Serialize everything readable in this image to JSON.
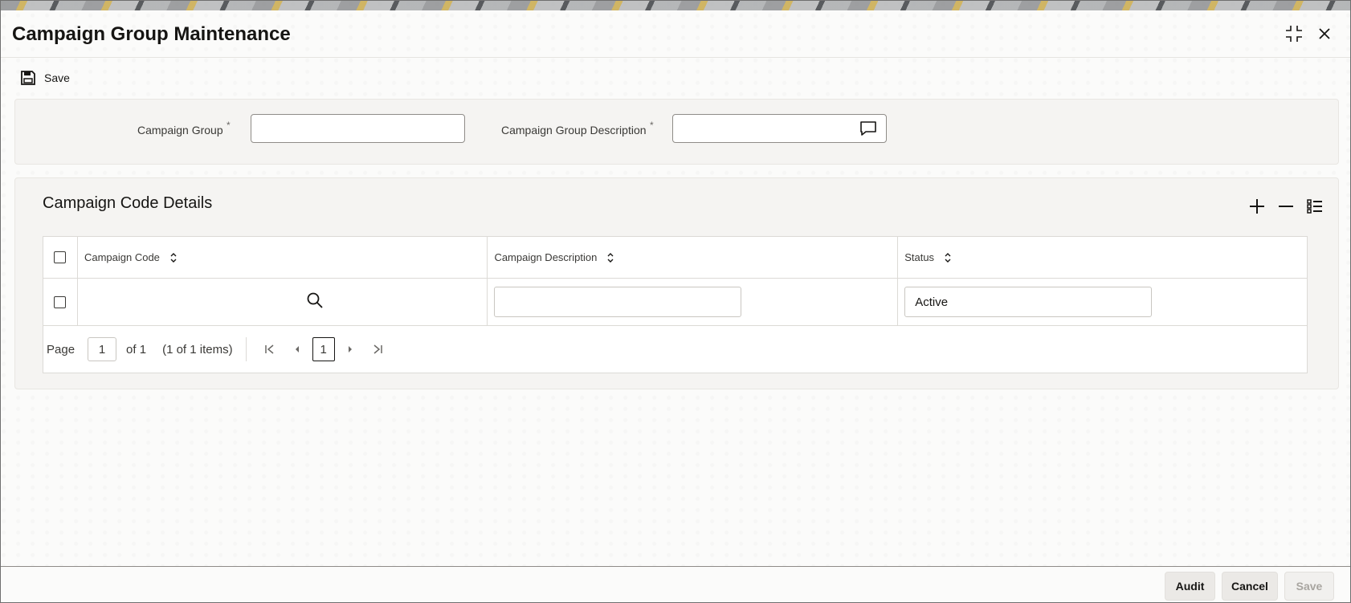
{
  "window": {
    "title": "Campaign Group Maintenance",
    "maximize_icon": "maximize-icon",
    "close_icon": "close-icon"
  },
  "toolbar": {
    "save_label": "Save",
    "save_icon": "floppy-disk-icon"
  },
  "form": {
    "campaign_group": {
      "label": "Campaign Group",
      "required_mark": "*",
      "value": ""
    },
    "campaign_group_description": {
      "label": "Campaign Group Description",
      "required_mark": "*",
      "value": "",
      "icon": "comment-icon"
    }
  },
  "details": {
    "title": "Campaign Code Details",
    "tools": {
      "add_icon": "plus-icon",
      "remove_icon": "minus-icon",
      "columns_icon": "list-settings-icon"
    },
    "columns": [
      {
        "label": "Campaign Code"
      },
      {
        "label": "Campaign Description"
      },
      {
        "label": "Status"
      }
    ],
    "rows": [
      {
        "campaign_code": "",
        "campaign_description": "",
        "status": "Active"
      }
    ],
    "pager": {
      "page_label": "Page",
      "page_value": "1",
      "of_label": "of 1",
      "items_label": "(1 of 1 items)",
      "current_page": "1"
    }
  },
  "footer": {
    "audit_label": "Audit",
    "cancel_label": "Cancel",
    "save_label": "Save"
  },
  "colors": {
    "text": "#161513",
    "panel": "#f5f4f2",
    "border": "#dcdad6",
    "disabled_text": "#a8a5a0"
  }
}
